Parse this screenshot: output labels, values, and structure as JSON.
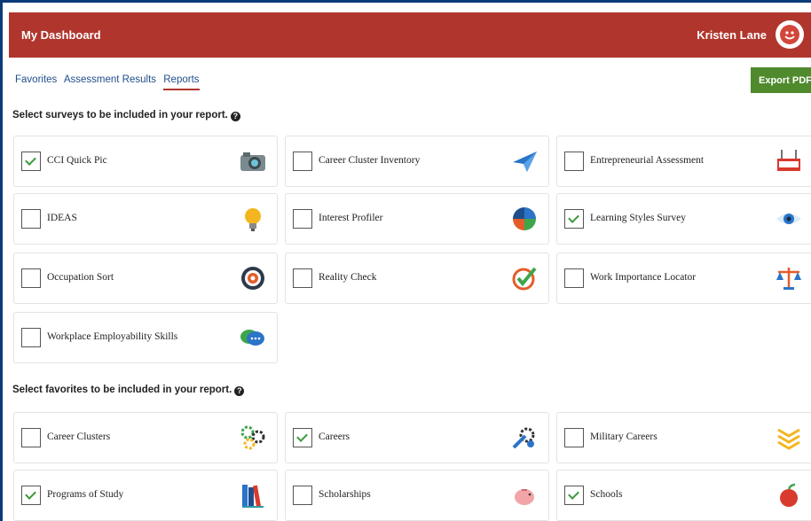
{
  "header": {
    "title": "My Dashboard",
    "user_name": "Kristen Lane"
  },
  "nav": {
    "tabs": [
      "Favorites",
      "Assessment Results",
      "Reports"
    ],
    "active": "Reports"
  },
  "export_button": "Export PDF",
  "surveys": {
    "title": "Select surveys to be included in your report.",
    "help": "?",
    "items": [
      {
        "label": "CCI Quick Pic",
        "checked": true,
        "icon": "camera-icon"
      },
      {
        "label": "Career Cluster Inventory",
        "checked": false,
        "icon": "paper-plane-icon"
      },
      {
        "label": "Entrepreneurial Assessment",
        "checked": false,
        "icon": "open-sign-icon"
      },
      {
        "label": "IDEAS",
        "checked": false,
        "icon": "lightbulb-icon"
      },
      {
        "label": "Interest Profiler",
        "checked": false,
        "icon": "puzzle-globe-icon"
      },
      {
        "label": "Learning Styles Survey",
        "checked": true,
        "icon": "eye-icon"
      },
      {
        "label": "Occupation Sort",
        "checked": false,
        "icon": "target-icon"
      },
      {
        "label": "Reality Check",
        "checked": false,
        "icon": "checkmark-icon"
      },
      {
        "label": "Work Importance Locator",
        "checked": false,
        "icon": "scales-icon"
      },
      {
        "label": "Workplace Employability Skills",
        "checked": false,
        "icon": "chat-bubbles-icon"
      }
    ]
  },
  "favorites": {
    "title": "Select favorites to be included in your report.",
    "help": "?",
    "items": [
      {
        "label": "Career Clusters",
        "checked": false,
        "icon": "gears-icon"
      },
      {
        "label": "Careers",
        "checked": true,
        "icon": "wrench-gear-icon"
      },
      {
        "label": "Military Careers",
        "checked": false,
        "icon": "chevrons-icon"
      },
      {
        "label": "Programs of Study",
        "checked": true,
        "icon": "books-icon"
      },
      {
        "label": "Scholarships",
        "checked": false,
        "icon": "piggy-bank-icon"
      },
      {
        "label": "Schools",
        "checked": true,
        "icon": "apple-icon"
      }
    ]
  }
}
